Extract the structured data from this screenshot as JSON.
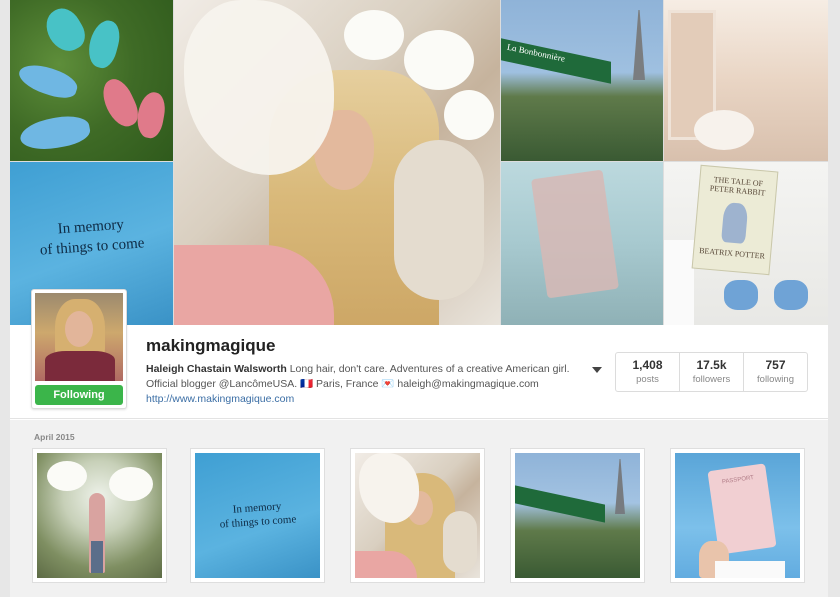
{
  "cover": {
    "memory_line1": "In memory",
    "memory_line2": "of things to come",
    "cafe_sign": "La Bonbonnière",
    "book_title": "THE TALE OF PETER RABBIT",
    "book_author": "BEATRIX POTTER"
  },
  "profile": {
    "username": "makingmagique",
    "full_name": "Haleigh Chastain Walsworth",
    "bio_line1": " Long hair, don't care. Adventures of a creative American girl.",
    "bio_line2": "Official blogger @LancômeUSA. 🇫🇷 Paris, France 💌 haleigh@makingmagique.com",
    "website": "http://www.makingmagique.com",
    "follow_button": "Following",
    "follow_button_color": "#3bb54a"
  },
  "stats": [
    {
      "value": "1,408",
      "label": "posts"
    },
    {
      "value": "17.5k",
      "label": "followers"
    },
    {
      "value": "757",
      "label": "following"
    }
  ],
  "feed": {
    "date_label": "April 2015",
    "thumb2_line1": "In memory",
    "thumb2_line2": "of things to come",
    "passport_label": "PASSPORT"
  }
}
